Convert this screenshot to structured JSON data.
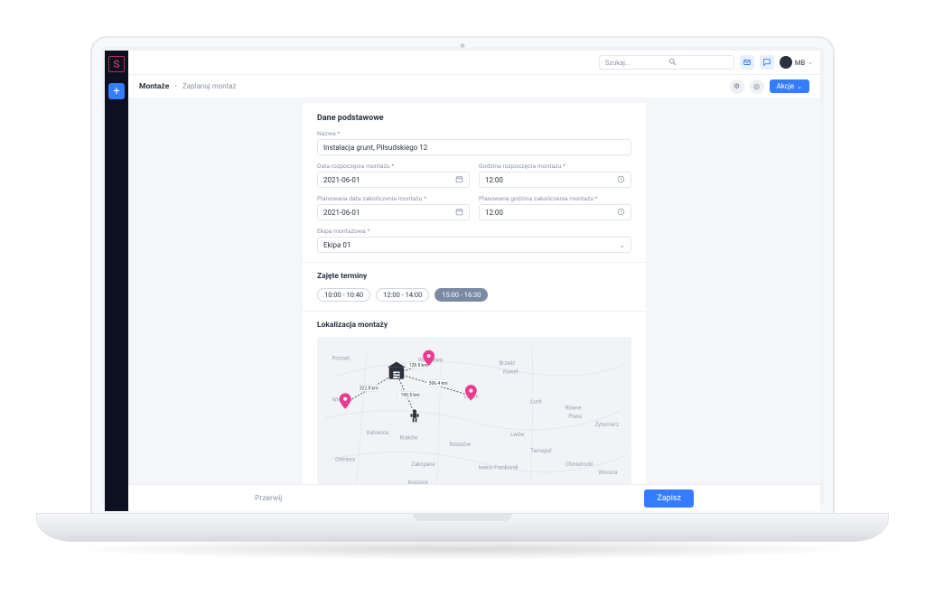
{
  "colors": {
    "accent": "#347dff",
    "pin": "#ec3a8f",
    "sidebar": "#0c1020"
  },
  "search": {
    "placeholder": "Szukaj..."
  },
  "user": {
    "initials": "MB"
  },
  "breadcrumb": {
    "root": "Montaże",
    "current": "Zaplanuj montaż"
  },
  "actions": {
    "label": "Akcje"
  },
  "section_basic": "Dane podstawowe",
  "fields": {
    "name": {
      "label": "Nazwa *",
      "value": "Instalacja grunt, Piłsudskiego 12"
    },
    "start_date": {
      "label": "Data rozpoczęcia montażu *",
      "value": "2021-06-01"
    },
    "start_time": {
      "label": "Godzina rozpoczęcia montażu *",
      "value": "12:00"
    },
    "end_date": {
      "label": "Planowana data zakończenia montażu *",
      "value": "2021-06-01"
    },
    "end_time": {
      "label": "Planowana godzina zakończenia montażu *",
      "value": "12:00"
    },
    "team": {
      "label": "Ekipa montażowa *",
      "value": "Ekipa 01"
    }
  },
  "busy": {
    "title": "Zajęte terminy",
    "slots": [
      "10:00 - 10:40",
      "12:00 - 14:00",
      "15:00 - 16:30"
    ],
    "active_index": 2
  },
  "map_section": {
    "title": "Lokalizacja montaży",
    "cities": [
      "Poznań",
      "Warszawa",
      "Brześć",
      "Wrocław",
      "Lublin",
      "Kraków",
      "Katowice",
      "Ostrawa",
      "Zakopane",
      "Rzeszów",
      "Równe",
      "Piane",
      "Żytomierz",
      "Tarnopol",
      "Chmielnicki",
      "Iwano-Frankiwsk",
      "Koszyce",
      "Winnica",
      "Koweł",
      "Łuck",
      "Lwów"
    ],
    "distances": [
      "128.5 km",
      "322.8 km",
      "190.5 km",
      "306.4 km"
    ]
  },
  "footer": {
    "cancel": "Przerwij",
    "save": "Zapisz"
  }
}
